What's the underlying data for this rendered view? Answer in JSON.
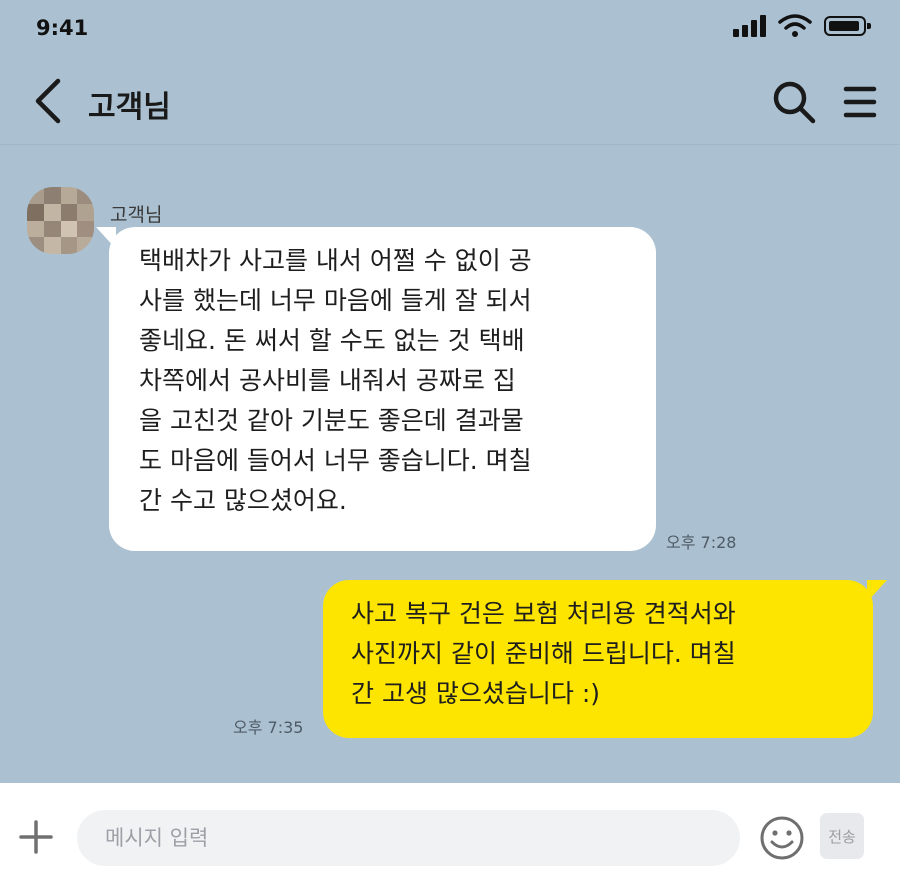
{
  "status_bar": {
    "time": "9:41",
    "icons": [
      "cellular-signal-icon",
      "wifi-icon",
      "battery-icon"
    ]
  },
  "header": {
    "title": "고객님",
    "icons": [
      "back-arrow-icon",
      "search-icon",
      "menu-icon"
    ]
  },
  "chat": {
    "background_color": "#abc1d1",
    "messages": [
      {
        "direction": "incoming",
        "sender": "고객님",
        "text": "택배차가 사고를 내서 어쩔 수 없이 공\n사를 했는데 너무 마음에 들게 잘 되서\n 좋네요. 돈 써서 할 수도 없는 것 택배\n차쪽에서 공사비를 내줘서 공짜로 집\n을 고친것 같아 기분도 좋은데 결과물\n도 마음에 들어서 너무 좋습니다. 며칠\n간 수고 많으셨어요.",
        "time": "오후 7:28",
        "bubble_color": "#ffffff"
      },
      {
        "direction": "outgoing",
        "text": "사고 복구 건은 보험 처리용 견적서와\n사진까지 같이 준비해 드립니다. 며칠\n간 고생 많으셨습니다 :)",
        "time": "오후 7:35",
        "bubble_color": "#fee500"
      }
    ]
  },
  "input_bar": {
    "placeholder": "메시지 입력",
    "value": "",
    "send_label": "전송",
    "icons": [
      "plus-icon",
      "emoji-icon"
    ]
  }
}
